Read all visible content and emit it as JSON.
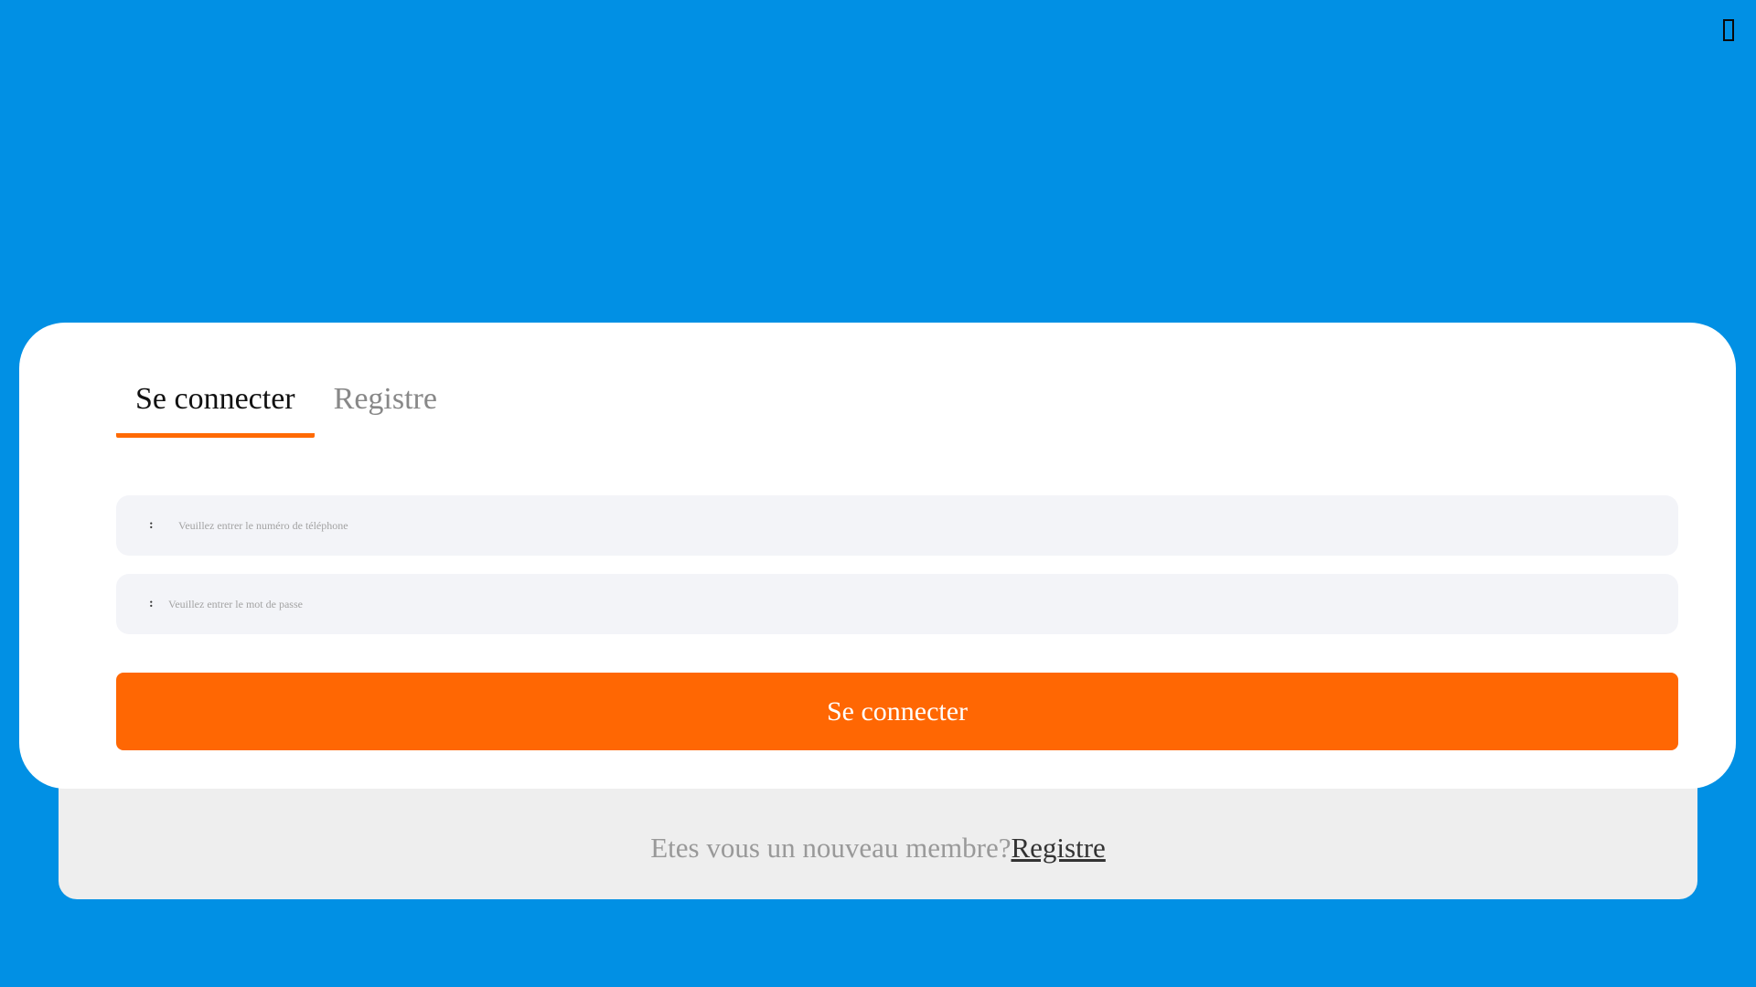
{
  "colors": {
    "background": "#0190e4",
    "accent": "#ff6703",
    "card": "#ffffff",
    "footer_panel": "#eeeeee",
    "input_background": "#f3f4f8"
  },
  "header": {
    "close_icon": "close-icon"
  },
  "tabs": [
    {
      "label": "Se connecter",
      "active": true
    },
    {
      "label": "Registre",
      "active": false
    }
  ],
  "form": {
    "phone": {
      "prefix": ":",
      "value": "",
      "placeholder": "Veuillez entrer le numéro de téléphone"
    },
    "password": {
      "prefix": ":",
      "value": "",
      "placeholder": "Veuillez entrer le mot de passe"
    },
    "submit_label": "Se connecter"
  },
  "footer": {
    "prompt": "Etes vous un nouveau membre?",
    "link_label": "Registre"
  }
}
